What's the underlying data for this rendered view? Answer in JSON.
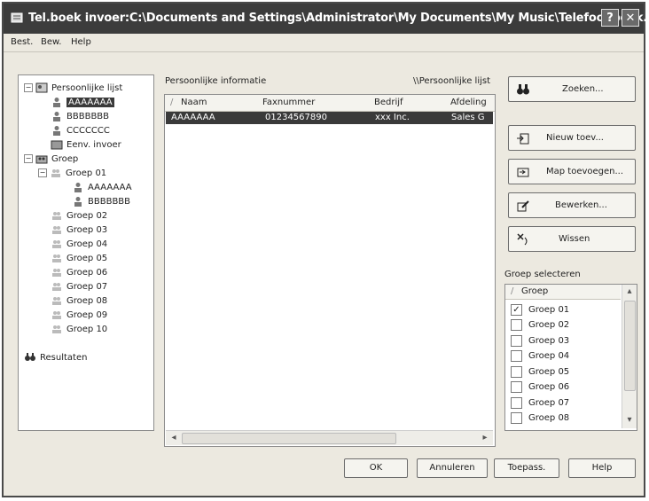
{
  "window": {
    "title": "Tel.boek invoer:C:\\Documents and Settings\\Administrator\\My Documents\\My Music\\Telefoonboek...",
    "help_btn": "?",
    "close_btn": "✕"
  },
  "menubar": [
    "Best.",
    "Bew.",
    "Help"
  ],
  "tree": {
    "root": "Persoonlijke lijst",
    "contacts": [
      "AAAAAAA",
      "BBBBBBB",
      "CCCCCCC"
    ],
    "multi": "Eenv. invoer",
    "group_root": "Groep",
    "groups": [
      "Groep 01",
      "Groep 02",
      "Groep 03",
      "Groep 04",
      "Groep 05",
      "Groep 06",
      "Groep 07",
      "Groep 08",
      "Groep 09",
      "Groep 10"
    ],
    "group01_members": [
      "AAAAAAA",
      "BBBBBBB"
    ],
    "results": "Resultaten"
  },
  "panel": {
    "title": "Persoonlijke informatie",
    "path": "\\\\Persoonlijke lijst"
  },
  "list": {
    "columns": [
      "Naam",
      "Faxnummer",
      "Bedrijf",
      "Afdeling"
    ],
    "rows": [
      [
        "AAAAAAA",
        "01234567890",
        "xxx Inc.",
        "Sales G"
      ]
    ]
  },
  "buttons": {
    "search": "Zoeken...",
    "new": "Nieuw toev...",
    "add_folder": "Map toevoegen...",
    "edit": "Bewerken...",
    "delete": "Wissen"
  },
  "group_select": {
    "label": "Groep selecteren",
    "header": "Groep",
    "items": [
      {
        "label": "Groep 01",
        "checked": true
      },
      {
        "label": "Groep 02",
        "checked": false
      },
      {
        "label": "Groep 03",
        "checked": false
      },
      {
        "label": "Groep 04",
        "checked": false
      },
      {
        "label": "Groep 05",
        "checked": false
      },
      {
        "label": "Groep 06",
        "checked": false
      },
      {
        "label": "Groep 07",
        "checked": false
      },
      {
        "label": "Groep 08",
        "checked": false
      }
    ]
  },
  "footer": {
    "ok": "OK",
    "cancel": "Annuleren",
    "apply": "Toepass.",
    "help": "Help"
  }
}
